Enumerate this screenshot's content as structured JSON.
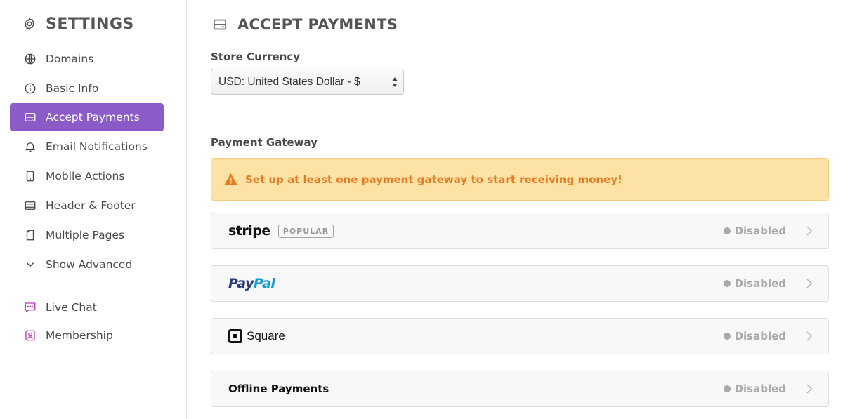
{
  "sidebar": {
    "title": "SETTINGS",
    "items": [
      {
        "label": "Domains",
        "icon": "globe-icon"
      },
      {
        "label": "Basic Info",
        "icon": "info-icon"
      },
      {
        "label": "Accept Payments",
        "icon": "wallet-icon",
        "active": true
      },
      {
        "label": "Email Notifications",
        "icon": "bell-icon"
      },
      {
        "label": "Mobile Actions",
        "icon": "mobile-icon"
      },
      {
        "label": "Header & Footer",
        "icon": "layout-icon"
      },
      {
        "label": "Multiple Pages",
        "icon": "page-icon"
      },
      {
        "label": "Show Advanced",
        "icon": "chevron-down-icon"
      }
    ],
    "apps": [
      {
        "label": "Live Chat",
        "icon": "chat-icon"
      },
      {
        "label": "Membership",
        "icon": "user-card-icon"
      }
    ]
  },
  "main": {
    "title": "ACCEPT PAYMENTS",
    "currency": {
      "label": "Store Currency",
      "selected": "USD: United States Dollar - $"
    },
    "gateway": {
      "label": "Payment Gateway",
      "warning": "Set up at least one payment gateway to start receiving money!",
      "providers": [
        {
          "name": "stripe",
          "badge": "POPULAR",
          "status": "Disabled"
        },
        {
          "name_pay": "Pay",
          "name_pal": "Pal",
          "status": "Disabled"
        },
        {
          "name": "Square",
          "status": "Disabled"
        },
        {
          "name": "Offline Payments",
          "status": "Disabled"
        }
      ]
    }
  },
  "colors": {
    "accent": "#8b5cc7",
    "warning_bg": "#fde2a6",
    "warning_text": "#ea7a22",
    "status_gray": "#a9a9a9",
    "app_icon": "#b83fb1"
  }
}
